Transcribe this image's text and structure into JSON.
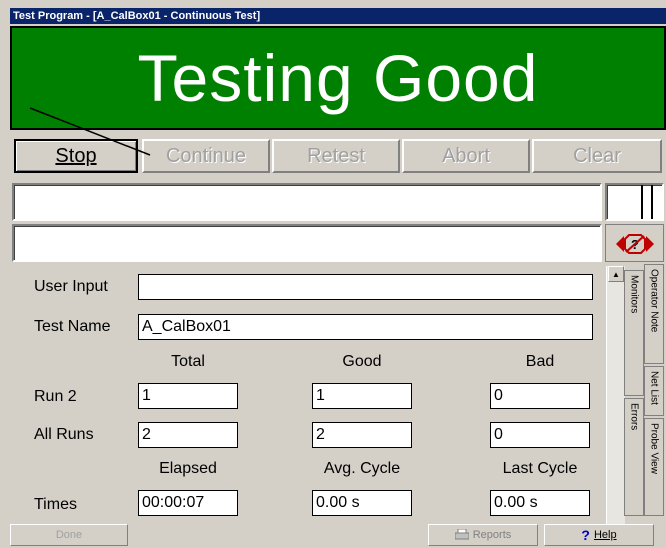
{
  "window": {
    "title": "Test Program - [A_CalBox01 - Continuous Test]"
  },
  "banner": {
    "status": "Testing Good",
    "color": "#008000"
  },
  "toolbar": {
    "stop": "Stop",
    "continue": "Continue",
    "retest": "Retest",
    "abort": "Abort",
    "clear": "Clear"
  },
  "form": {
    "user_input_label": "User Input",
    "user_input_value": "",
    "test_name_label": "Test Name",
    "test_name_value": "A_CalBox01",
    "headers1": {
      "total": "Total",
      "good": "Good",
      "bad": "Bad"
    },
    "run_label": "Run 2",
    "run": {
      "total": "1",
      "good": "1",
      "bad": "0"
    },
    "allruns_label": "All Runs",
    "allruns": {
      "total": "2",
      "good": "2",
      "bad": "0"
    },
    "headers2": {
      "elapsed": "Elapsed",
      "avg_cycle": "Avg. Cycle",
      "last_cycle": "Last Cycle"
    },
    "times_label": "Times",
    "times": {
      "elapsed": "00:00:07",
      "avg_cycle": "0.00 s",
      "last_cycle": "0.00 s"
    }
  },
  "side_tabs": {
    "monitors": "Monitors",
    "errors": "Errors",
    "operator_note": "Operator Note",
    "net_list": "Net List",
    "probe_view": "Probe View"
  },
  "statusbar": {
    "done": "Done",
    "reports": "Reports",
    "help": "Help"
  },
  "icons": [
    "stop-sign-arrows-icon",
    "printer-icon",
    "help-question-icon"
  ]
}
